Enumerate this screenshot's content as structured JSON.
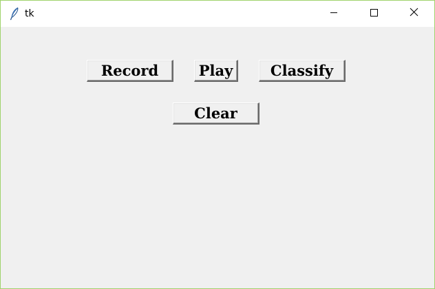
{
  "window": {
    "title": "tk",
    "icon": "feather-icon",
    "controls": {
      "minimize_icon": "minimize-icon",
      "maximize_icon": "maximize-icon",
      "close_icon": "close-icon"
    }
  },
  "buttons": {
    "record_label": "Record",
    "play_label": "Play",
    "classify_label": "Classify",
    "clear_label": "Clear"
  },
  "colors": {
    "window_background": "#f0f0f0",
    "titlebar_background": "#ffffff",
    "window_border": "#9fd36b"
  }
}
